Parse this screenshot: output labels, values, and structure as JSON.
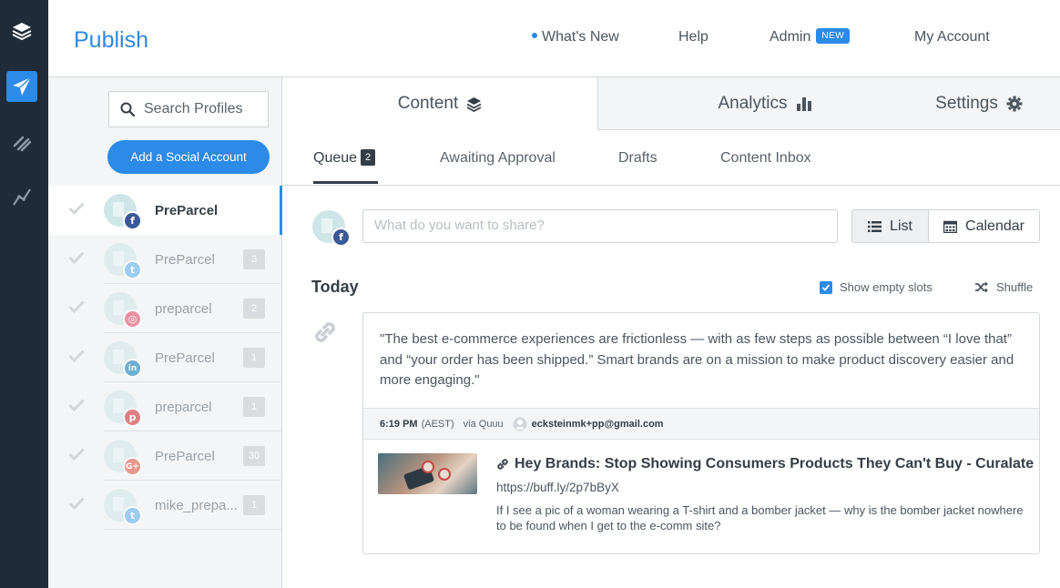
{
  "app": {
    "brand": "Publish"
  },
  "topnav": {
    "whats_new": "What's New",
    "help": "Help",
    "admin": "Admin",
    "admin_badge": "NEW",
    "my_account": "My Account"
  },
  "sidebar": {
    "search_placeholder": "Search Profiles",
    "add_account": "Add a Social Account",
    "profiles": [
      {
        "name": "PreParcel",
        "network": "facebook",
        "count": "",
        "active": true
      },
      {
        "name": "PreParcel",
        "network": "twitter",
        "count": "3",
        "active": false
      },
      {
        "name": "preparcel",
        "network": "instagram",
        "count": "2",
        "active": false
      },
      {
        "name": "PreParcel",
        "network": "linkedin",
        "count": "1",
        "active": false
      },
      {
        "name": "preparcel",
        "network": "pinterest",
        "count": "1",
        "active": false
      },
      {
        "name": "PreParcel",
        "network": "google-plus",
        "count": "30",
        "active": false
      },
      {
        "name": "mike_prepa...",
        "network": "twitter",
        "count": "1",
        "active": false
      }
    ]
  },
  "tabs": {
    "content": "Content",
    "analytics": "Analytics",
    "settings": "Settings"
  },
  "subtabs": {
    "queue": "Queue",
    "queue_count": "2",
    "awaiting": "Awaiting Approval",
    "drafts": "Drafts",
    "inbox": "Content Inbox"
  },
  "composer": {
    "placeholder": "What do you want to share?"
  },
  "view": {
    "list": "List",
    "calendar": "Calendar"
  },
  "queue": {
    "day_label": "Today",
    "show_empty_slots": "Show empty slots",
    "show_empty_slots_checked": true,
    "shuffle": "Shuffle"
  },
  "post": {
    "text": "\"The best e-commerce experiences are frictionless — with as few steps as possible between “I love that” and “your order has been shipped.” Smart brands are on a mission to make product discovery easier and more engaging.\"",
    "time": "6:19 PM",
    "timezone": "(AEST)",
    "via": "via Quuu",
    "email": "ecksteinmk+pp@gmail.com",
    "link_title": "Hey Brands: Stop Showing Consumers Products They Can't Buy - Curalate",
    "link_url": "https://buff.ly/2p7bByX",
    "link_desc": "If I see a pic of a woman wearing a T-shirt and a bomber jacket — why is the bomber jacket nowhere to be found when I get to the e-comm site?"
  },
  "colors": {
    "accent": "#2c8ae8",
    "rail": "#1f2b38",
    "facebook": "#3b5998",
    "twitter": "#55acee",
    "instagram": "#e4405f",
    "linkedin": "#0077b5",
    "pinterest": "#cb2027",
    "google-plus": "#dd4b39"
  }
}
